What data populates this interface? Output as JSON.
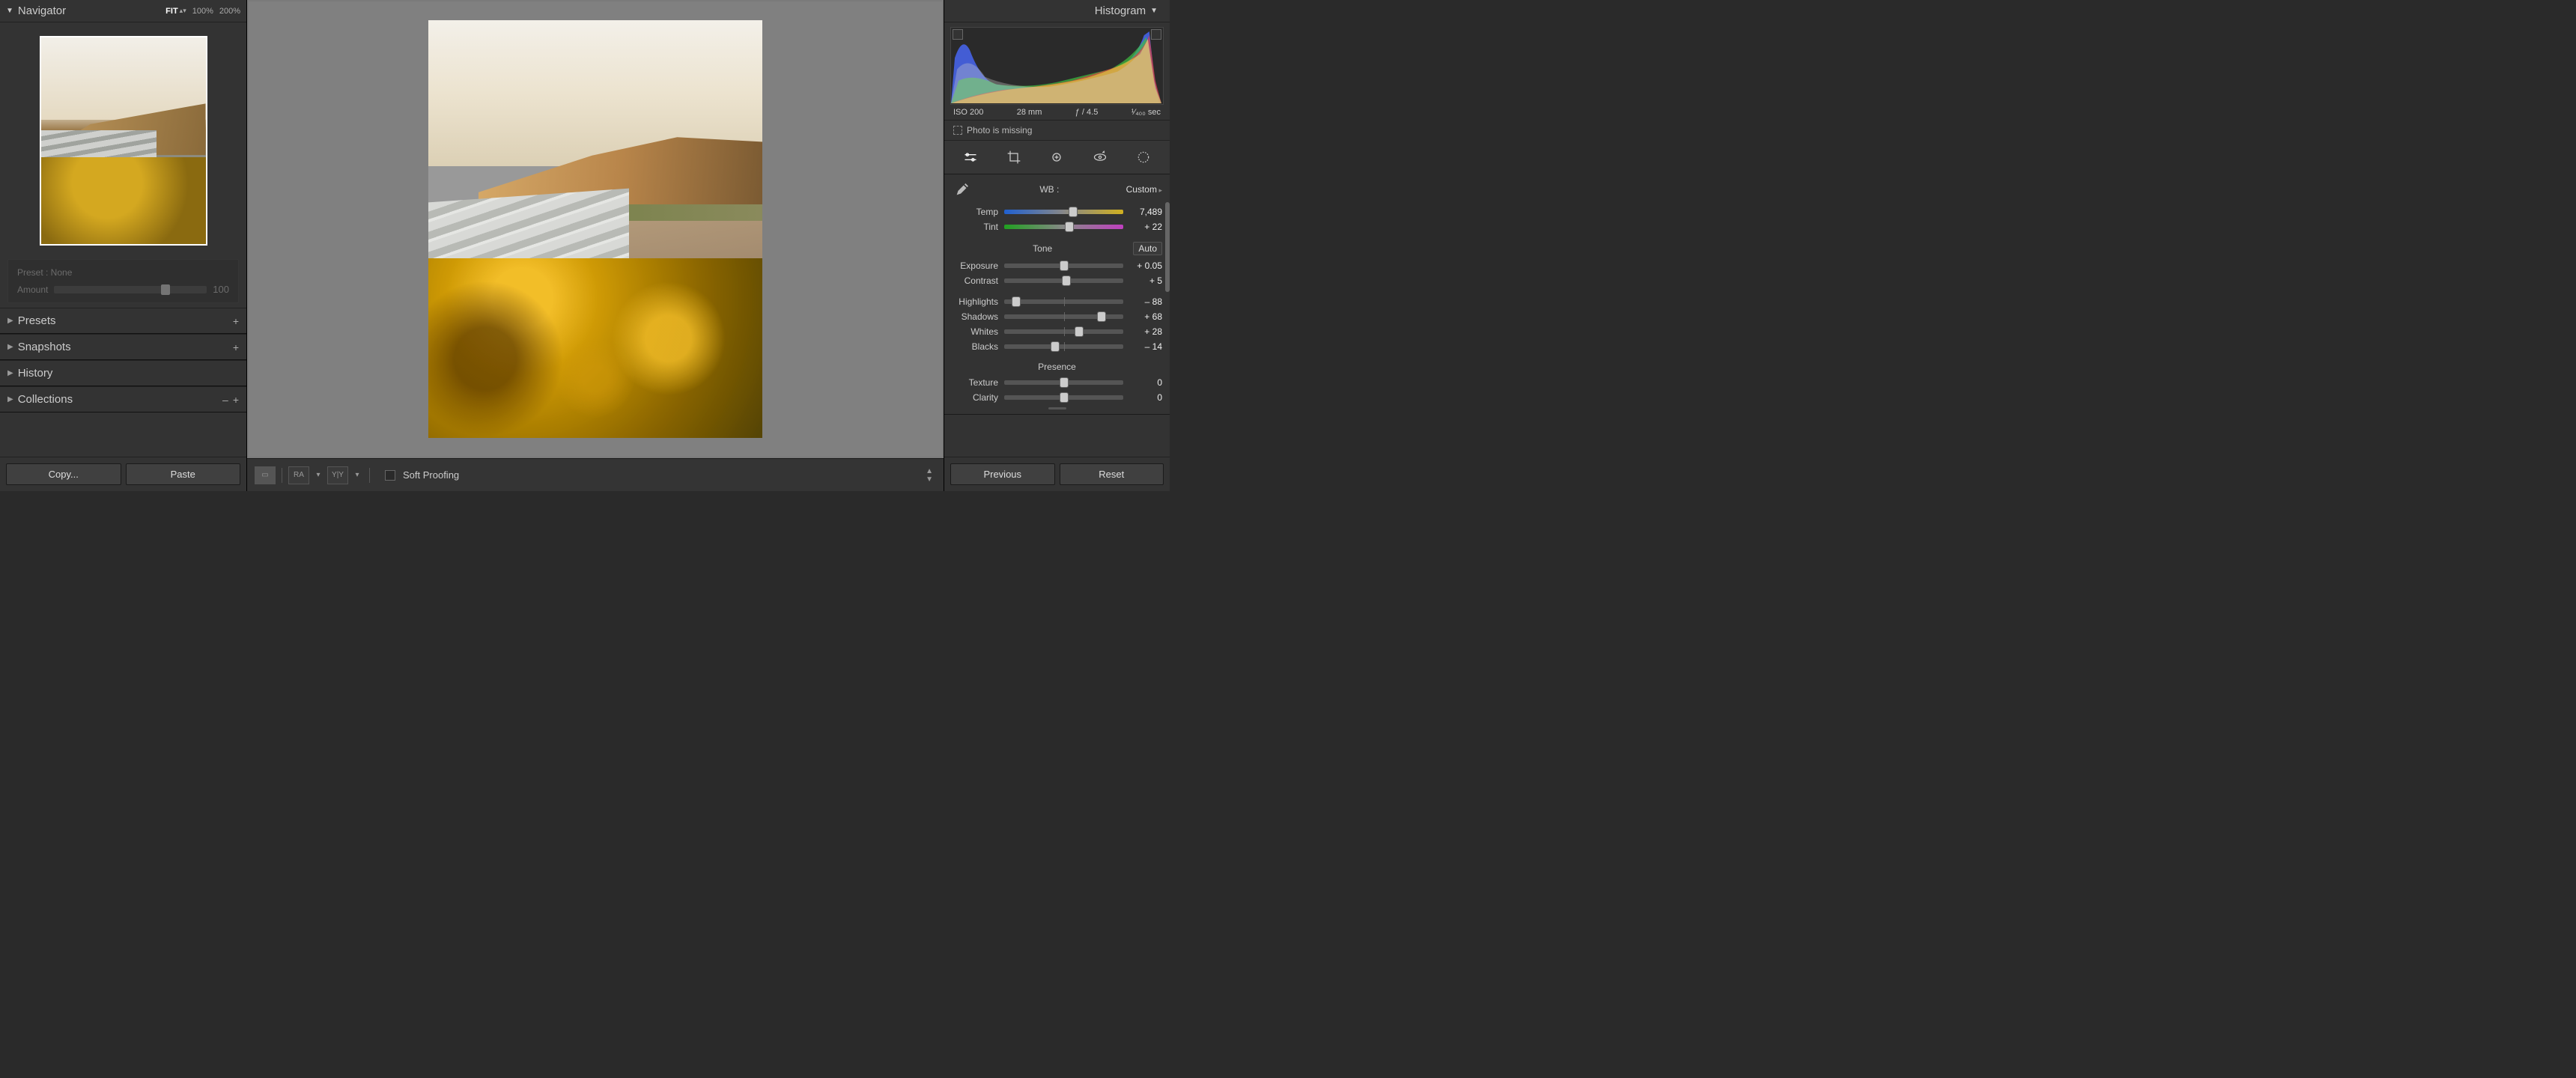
{
  "left": {
    "navigator": "Navigator",
    "zoom": {
      "fit": "FIT",
      "p100": "100%",
      "p200": "200%"
    },
    "preset_label": "Preset : None",
    "amount_label": "Amount",
    "amount_value": "100",
    "sections": {
      "presets": "Presets",
      "snapshots": "Snapshots",
      "history": "History",
      "collections": "Collections"
    },
    "copy": "Copy...",
    "paste": "Paste"
  },
  "toolbar": {
    "soft_proofing": "Soft Proofing"
  },
  "right": {
    "histogram": "Histogram",
    "meta": {
      "iso": "ISO 200",
      "focal": "28 mm",
      "aperture": "ƒ / 4.5",
      "shutter": "¹⁄₄₀₀ sec"
    },
    "missing": "Photo is missing",
    "wb": {
      "label": "WB :",
      "value": "Custom"
    },
    "tone_header": "Tone",
    "auto": "Auto",
    "presence_header": "Presence",
    "sliders": {
      "temp": {
        "label": "Temp",
        "value": "7,489",
        "pos": 58
      },
      "tint": {
        "label": "Tint",
        "value": "+ 22",
        "pos": 55
      },
      "exposure": {
        "label": "Exposure",
        "value": "+ 0.05",
        "pos": 50
      },
      "contrast": {
        "label": "Contrast",
        "value": "+ 5",
        "pos": 52
      },
      "highlights": {
        "label": "Highlights",
        "value": "– 88",
        "pos": 10
      },
      "shadows": {
        "label": "Shadows",
        "value": "+ 68",
        "pos": 82
      },
      "whites": {
        "label": "Whites",
        "value": "+ 28",
        "pos": 63
      },
      "blacks": {
        "label": "Blacks",
        "value": "– 14",
        "pos": 43
      },
      "texture": {
        "label": "Texture",
        "value": "0",
        "pos": 50
      },
      "clarity": {
        "label": "Clarity",
        "value": "0",
        "pos": 50
      }
    },
    "previous": "Previous",
    "reset": "Reset"
  }
}
